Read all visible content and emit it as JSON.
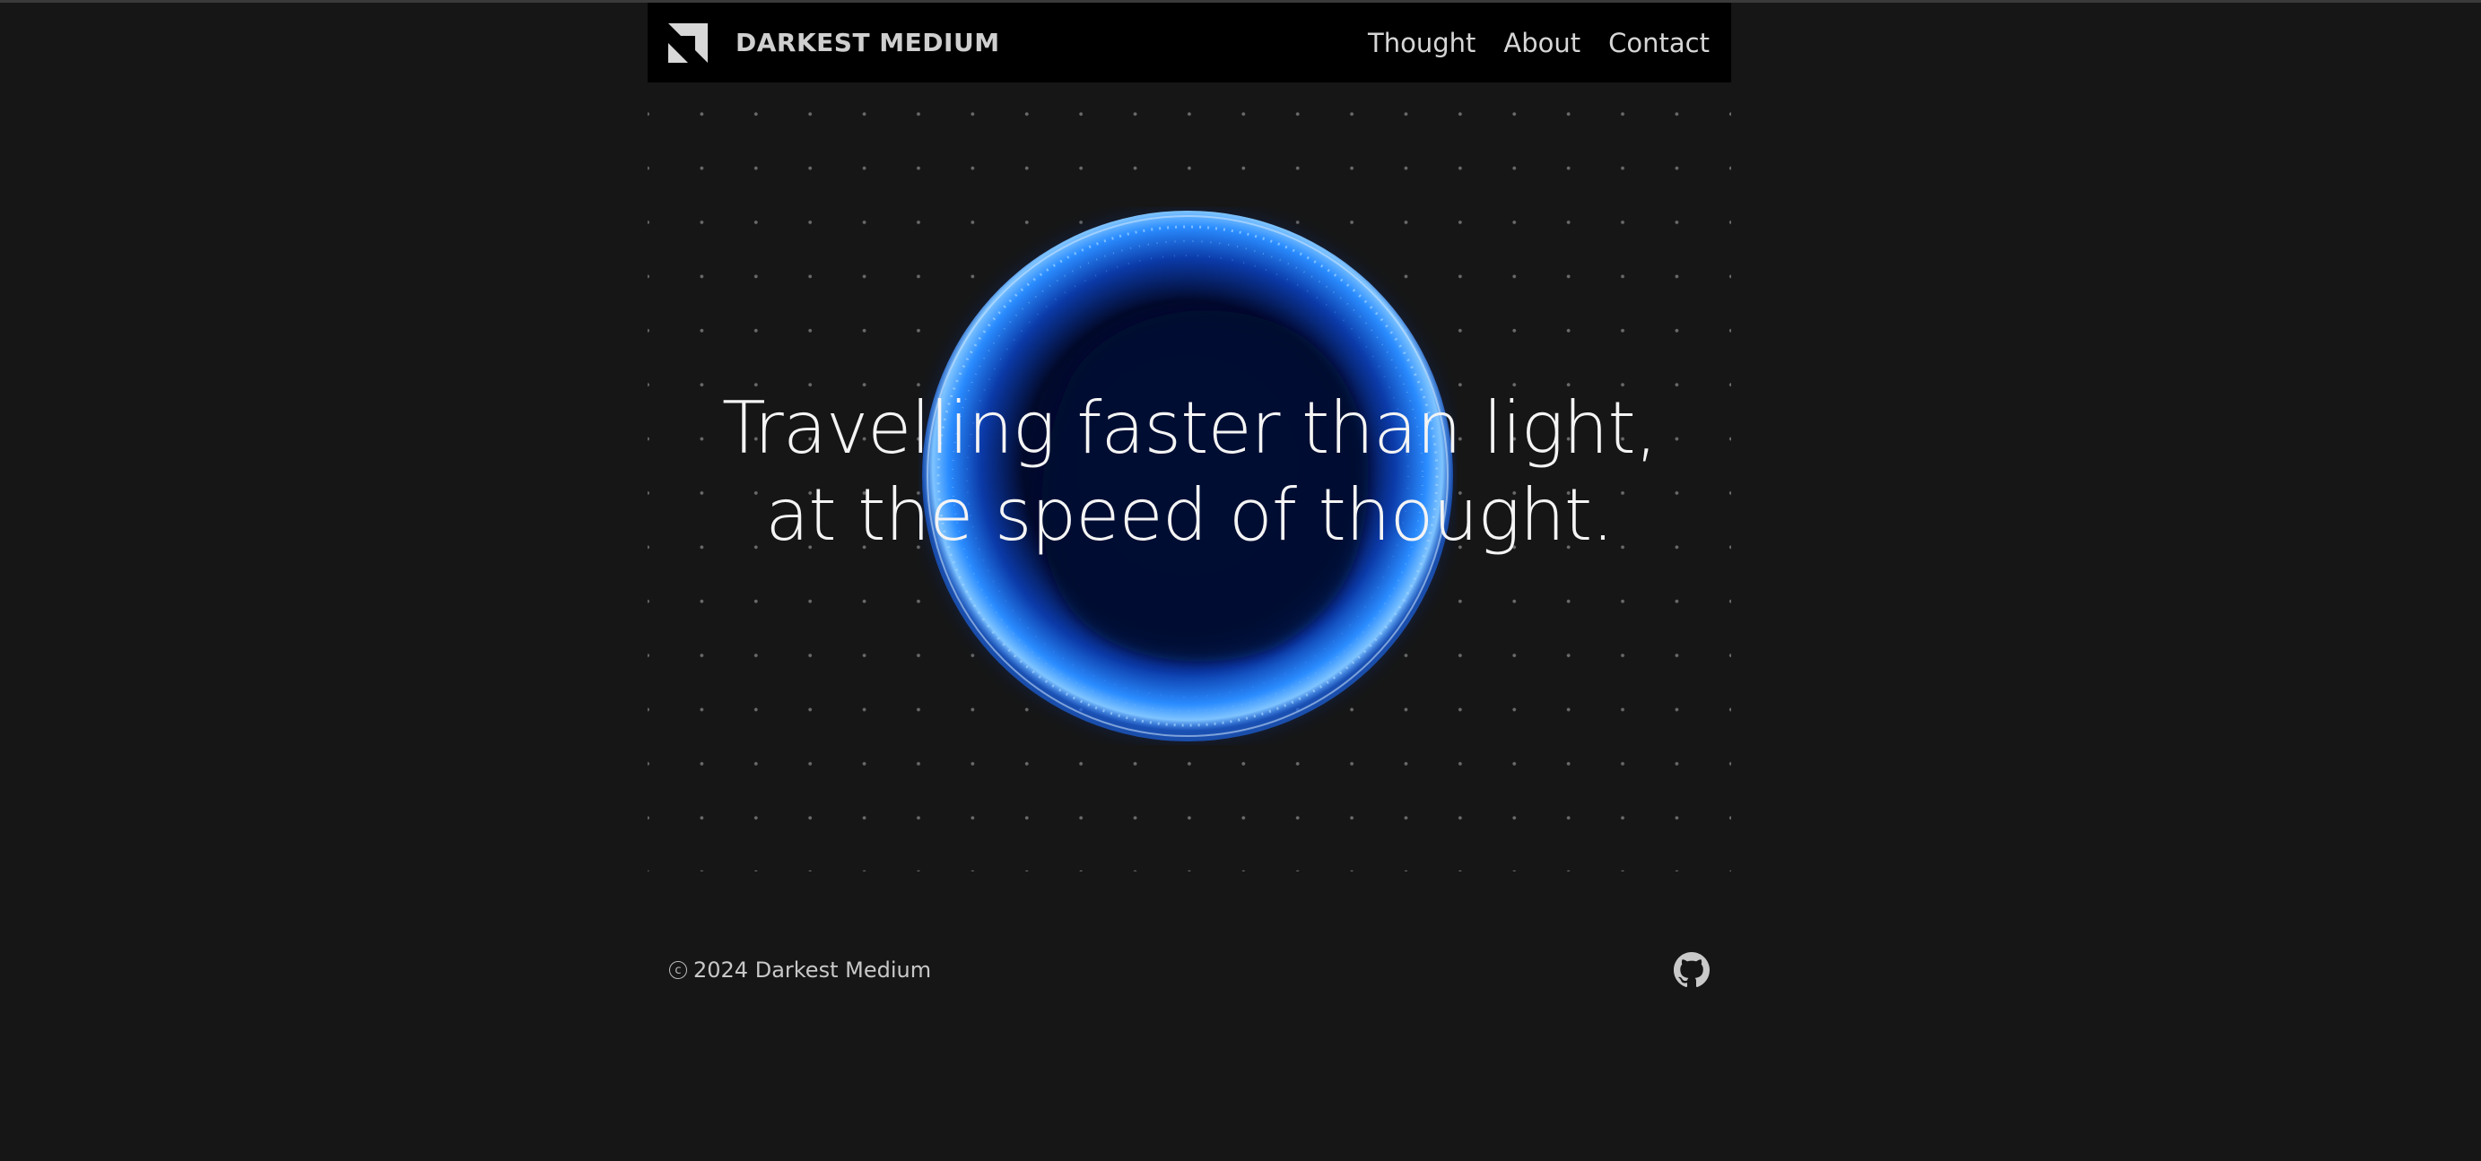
{
  "header": {
    "brand_name": "DARKEST MEDIUM",
    "logo_icon": "folded-corner-logo",
    "nav": [
      {
        "label": "Thought"
      },
      {
        "label": "About"
      },
      {
        "label": "Contact"
      }
    ]
  },
  "hero": {
    "headline_line1": "Travelling faster than light,",
    "headline_line2": "at the speed of thought."
  },
  "footer": {
    "copyright_symbol": "c",
    "copyright_text": "2024 Darkest Medium",
    "github_icon": "github-icon"
  },
  "colors": {
    "background": "#161616",
    "header": "#000000",
    "orb_glow": "#1e7bff",
    "orb_core": "#020a2a"
  }
}
